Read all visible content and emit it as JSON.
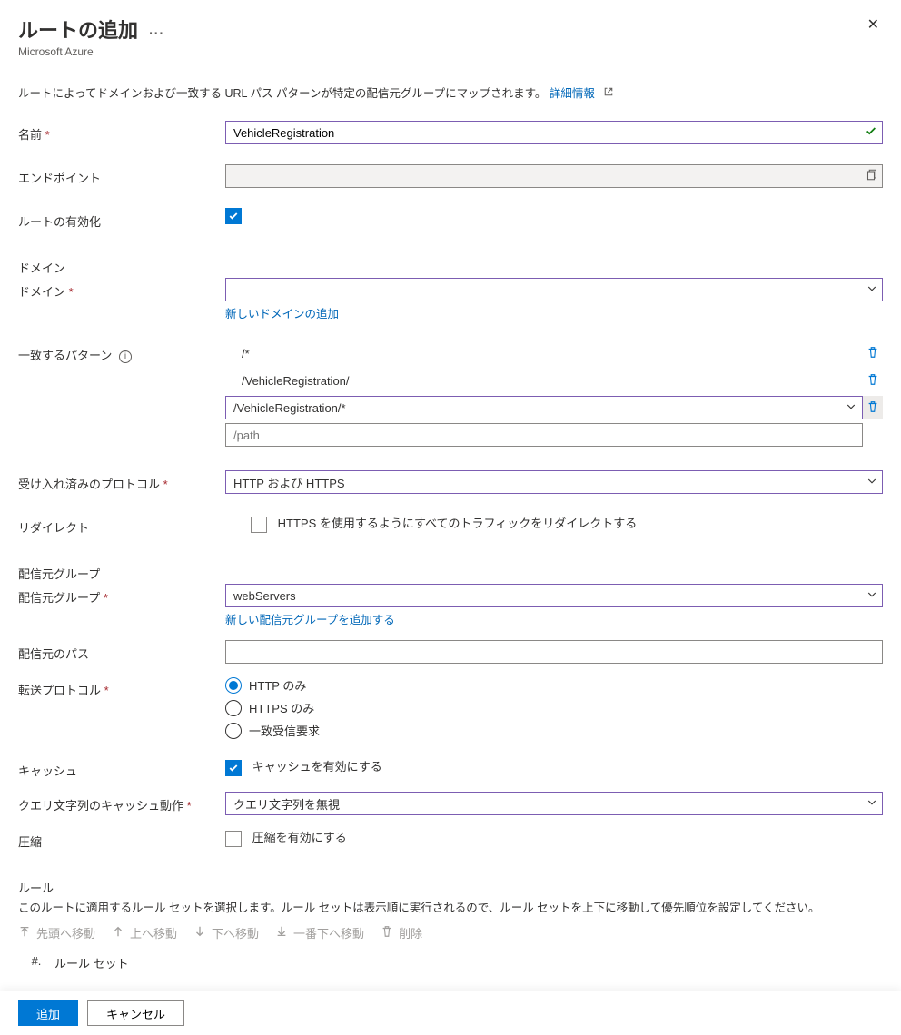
{
  "header": {
    "title": "ルートの追加",
    "subtitle": "Microsoft Azure"
  },
  "intro": {
    "text": "ルートによってドメインおよび一致する URL パス パターンが特定の配信元グループにマップされます。",
    "link_label": "詳細情報"
  },
  "labels": {
    "name": "名前",
    "endpoint": "エンドポイント",
    "enable_route": "ルートの有効化",
    "domain_section": "ドメイン",
    "domain": "ドメイン",
    "add_domain": "新しいドメインの追加",
    "patterns": "一致するパターン",
    "accepted_protocols": "受け入れ済みのプロトコル",
    "redirect": "リダイレクト",
    "redirect_option": "HTTPS を使用するようにすべてのトラフィックをリダイレクトする",
    "origin_group_section": "配信元グループ",
    "origin_group": "配信元グループ",
    "add_origin_group": "新しい配信元グループを追加する",
    "origin_path": "配信元のパス",
    "forwarding_protocol": "転送プロトコル",
    "cache": "キャッシュ",
    "cache_option": "キャッシュを有効にする",
    "query_behavior": "クエリ文字列のキャッシュ動作",
    "compression": "圧縮",
    "compression_option": "圧縮を有効にする",
    "rules_section": "ルール",
    "rules_desc": "このルートに適用するルール セットを選択します。ルール セットは表示順に実行されるので、ルール セットを上下に移動して優先順位を設定してください。"
  },
  "toolbar": {
    "move_top": "先頭へ移動",
    "move_up": "上へ移動",
    "move_down": "下へ移動",
    "move_bottom": "一番下へ移動",
    "delete": "削除"
  },
  "values": {
    "name": "VehicleRegistration",
    "endpoint": "",
    "enable_route": true,
    "domain_value": "",
    "patterns": [
      "/*",
      "/VehicleRegistration/"
    ],
    "pattern_active": "/VehicleRegistration/*",
    "pattern_placeholder": "/path",
    "accepted_protocols": "HTTP および HTTPS",
    "redirect_https": false,
    "origin_group": "webServers",
    "origin_path": "",
    "forwarding_protocol_options": [
      "HTTP のみ",
      "HTTPS のみ",
      "一致受信要求"
    ],
    "forwarding_protocol_selected": 0,
    "cache_enabled": true,
    "query_behavior": "クエリ文字列を無視",
    "compression_enabled": false
  },
  "rules_columns": {
    "num": "#.",
    "name": "ルール セット"
  },
  "footer": {
    "add": "追加",
    "cancel": "キャンセル"
  }
}
